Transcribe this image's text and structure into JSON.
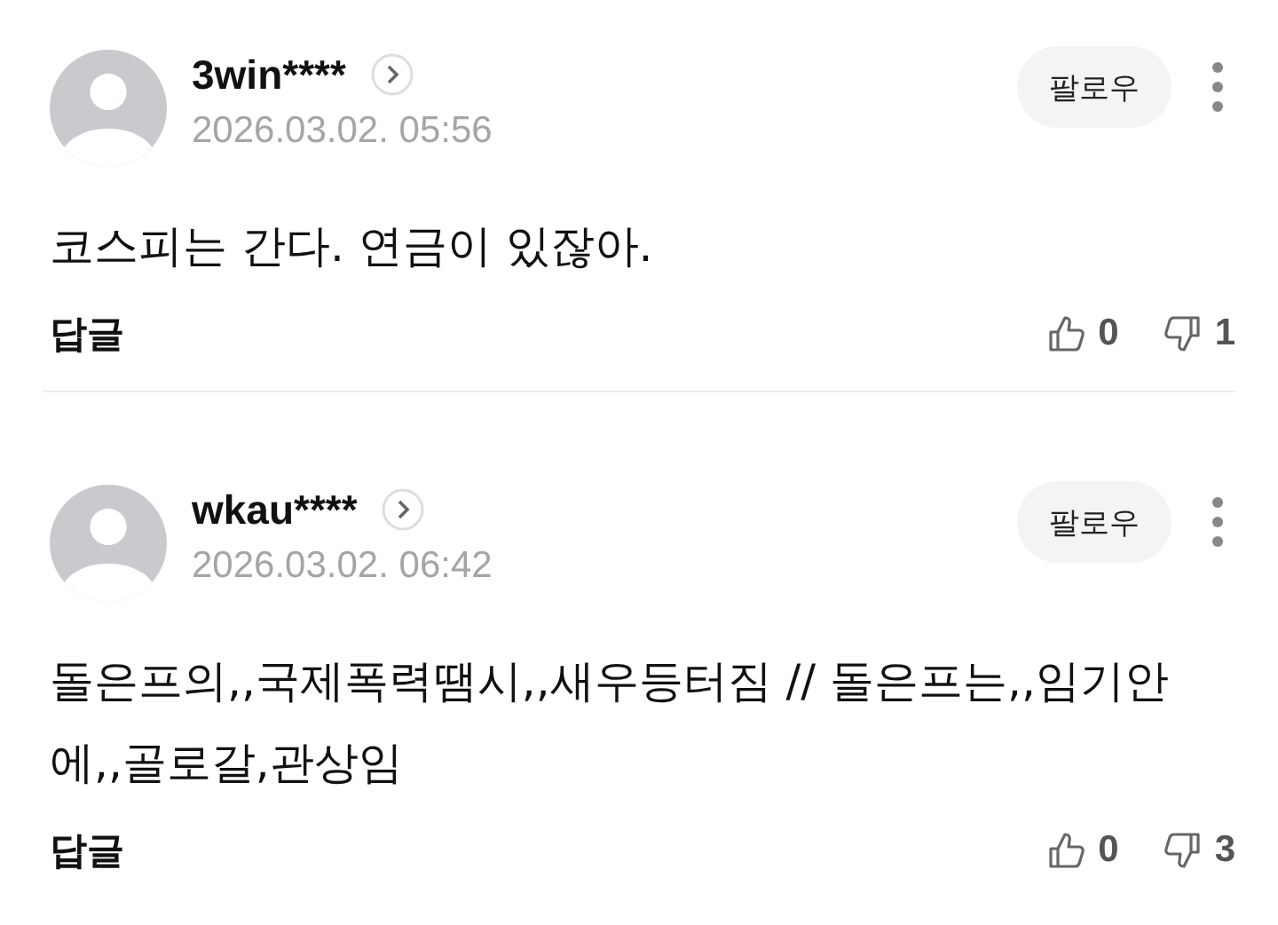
{
  "comments": [
    {
      "username": "3win****",
      "date": "2026.03.02. 05:56",
      "text": "코스피는 간다. 연금이 있잖아.",
      "follow": "팔로우",
      "reply": "답글",
      "likes": "0",
      "dislikes": "1"
    },
    {
      "username": "wkau****",
      "date": "2026.03.02. 06:42",
      "text": "돌은프의,,국제폭력땜시,,새우등터짐 // 돌은프는,,임기안에,,골로갈,관상임",
      "follow": "팔로우",
      "reply": "답글",
      "likes": "0",
      "dislikes": "3"
    }
  ]
}
